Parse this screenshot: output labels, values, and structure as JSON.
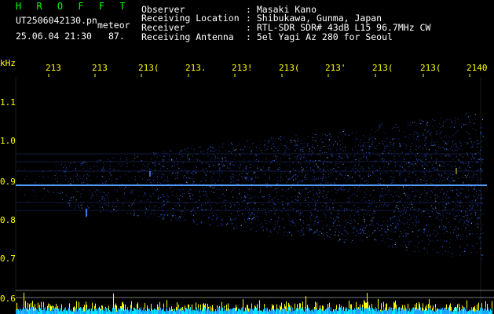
{
  "header": {
    "brand": "H R O F F T",
    "filename": "UT2506042130.pn",
    "tag": "meteor",
    "datetime": "25.06.04 21:30",
    "count": "87.",
    "fields": [
      {
        "label": "Observer",
        "value": ": Masaki Kano"
      },
      {
        "label": "Receiving Location",
        "value": ": Shibukawa, Gunma, Japan"
      },
      {
        "label": "Receiver",
        "value": ": RTL-SDR SDR# 43dB L15 96.7MHz CW"
      },
      {
        "label": "Receiving Antenna",
        "value": ": 5el Yagi Az 280 for Seoul"
      }
    ]
  },
  "axes": {
    "y_unit": "kHz",
    "y_ticks": [
      "1.1",
      "1.0",
      "0.9",
      "0.8",
      "0.7",
      "0.6"
    ],
    "x_ticks": [
      "213",
      "213",
      "213(",
      "213.",
      "213!",
      "213(",
      "213'",
      "213(",
      "213(",
      "2140"
    ]
  },
  "colors": {
    "background": "#000000",
    "label": "#ffff00",
    "header_text": "#ffffff",
    "brand": "#00ff00",
    "signal": "#3a7dff",
    "carrier": "#7fd7ff"
  }
}
